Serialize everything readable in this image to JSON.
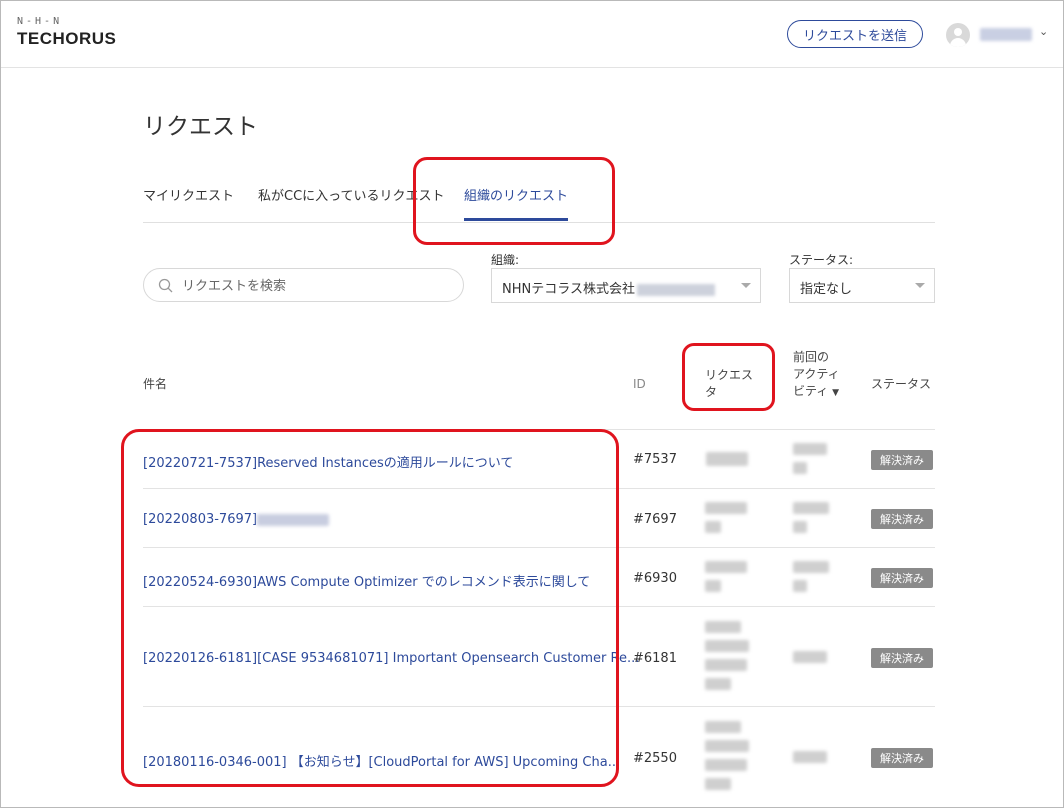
{
  "header": {
    "logo_mark": "N-H-N",
    "logo_text": "TECHORUS",
    "send_request_label": "リクエストを送信",
    "user_caret": "⌄"
  },
  "page": {
    "title": "リクエスト",
    "tabs": [
      {
        "label": "マイリクエスト",
        "active": false
      },
      {
        "label": "私がCCに入っているリクエスト",
        "active": false
      },
      {
        "label": "組織のリクエスト",
        "active": true
      }
    ]
  },
  "filters": {
    "search_placeholder": "リクエストを検索",
    "org_label": "組織:",
    "org_value": "NHNテコラス株式会社",
    "status_label": "ステータス:",
    "status_value": "指定なし"
  },
  "table": {
    "headers": {
      "subject": "件名",
      "id": "ID",
      "requester": "リクエスタ",
      "last_activity": "前回のアクティビティ",
      "status": "ステータス",
      "sort_indicator": "▼"
    },
    "rows": [
      {
        "title": "[20220721-7537]Reserved Instancesの適用ルールについて",
        "id": "#7537",
        "status": "解決済み"
      },
      {
        "title": "[20220803-7697]",
        "id": "#7697",
        "status": "解決済み"
      },
      {
        "title": "[20220524-6930]AWS Compute Optimizer でのレコメンド表示に関して",
        "id": "#6930",
        "status": "解決済み"
      },
      {
        "title": "[20220126-6181][CASE 9534681071] Important Opensearch Customer Re...",
        "id": "#6181",
        "status": "解決済み"
      },
      {
        "title": "[20180116-0346-001] 【お知らせ】[CloudPortal for AWS] Upcoming Cha...",
        "id": "#2550",
        "status": "解決済み"
      }
    ]
  },
  "colors": {
    "accent": "#2d4a9b",
    "highlight": "#e0141e",
    "badge": "#8a8a8a"
  }
}
